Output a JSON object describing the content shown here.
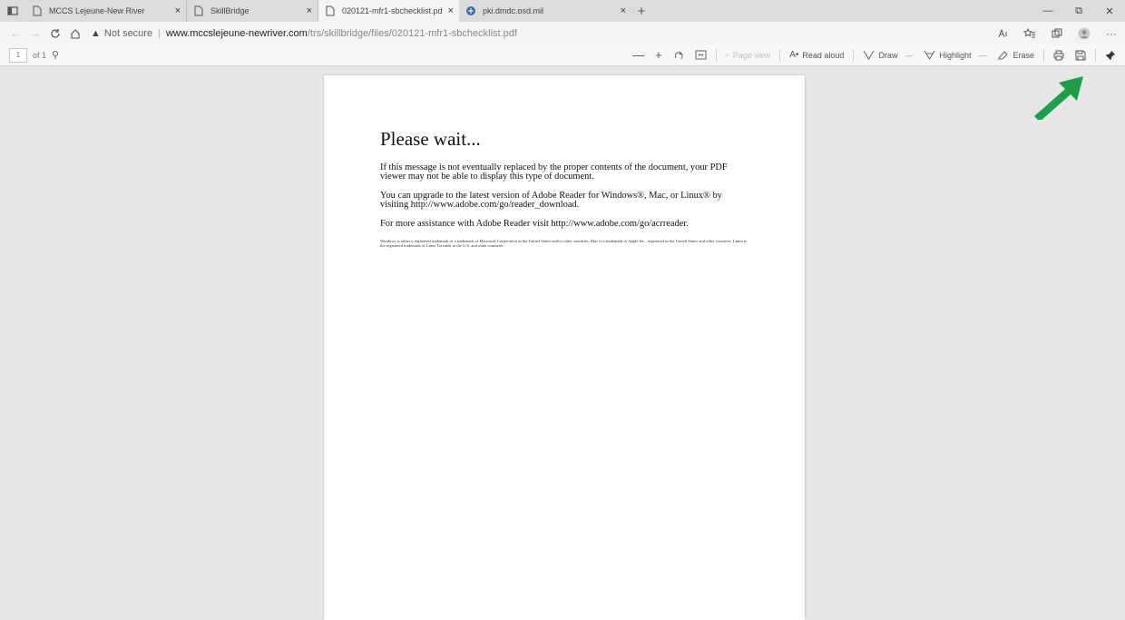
{
  "tabs": [
    {
      "title": "MCCS Lejeune-New River",
      "active": false
    },
    {
      "title": "SkillBridge",
      "active": false
    },
    {
      "title": "020121-mfr1-sbchecklist.pdf",
      "active": true
    },
    {
      "title": "pki.dmdc.osd.mil",
      "active": false
    }
  ],
  "tab_close_glyph": "×",
  "newtab_glyph": "+",
  "window": {
    "minimize": "—",
    "maximize": "⧉",
    "close": "✕"
  },
  "address": {
    "security_warning": "Not secure",
    "host": "www.mccslejeune-newriver.com",
    "path": "/trs/skillbridge/files/020121-mfr1-sbchecklist.pdf"
  },
  "pdf_toolbar": {
    "page_number": "1",
    "page_count": "of 1",
    "page_view_label": "Page view",
    "read_aloud": "Read aloud",
    "draw": "Draw",
    "highlight": "Highlight",
    "erase": "Erase"
  },
  "document": {
    "heading": "Please wait...",
    "paragraphs": [
      "If this message is not eventually replaced by the proper contents of the document, your PDF viewer may not be able to display this type of document.",
      "You can upgrade to the latest version of Adobe Reader for Windows®, Mac, or Linux® by visiting  http://www.adobe.com/go/reader_download.",
      "For more assistance with Adobe Reader visit  http://www.adobe.com/go/acrreader."
    ],
    "fine_print": "Windows is either a registered trademark or a trademark of Microsoft Corporation in the United States and/or other countries. Mac is a trademark of Apple Inc., registered in the United States and other countries. Linux is the registered trademark of Linus Torvalds in the U.S. and other countries."
  },
  "colors": {
    "annotation_arrow": "#1f9e4a",
    "page_background": "#e6e6e6"
  }
}
